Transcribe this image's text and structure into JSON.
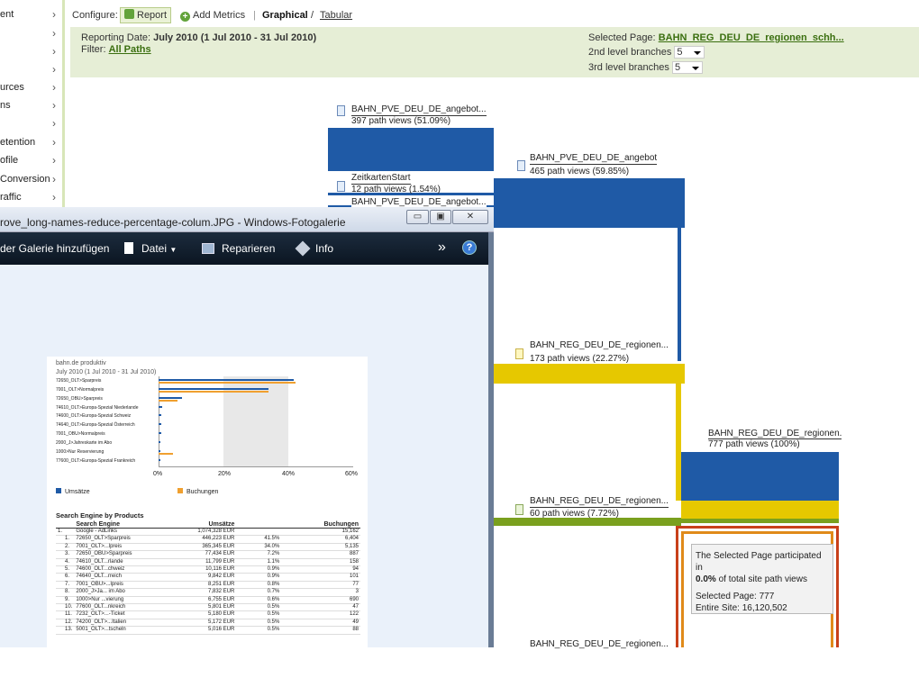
{
  "left_nav": {
    "items": [
      {
        "label": "ent"
      },
      {
        "label": ""
      },
      {
        "label": ""
      },
      {
        "label": ""
      },
      {
        "label": "urces"
      },
      {
        "label": "ns"
      },
      {
        "label": ""
      },
      {
        "label": "etention"
      },
      {
        "label": "ofile"
      },
      {
        "label": "Conversion"
      },
      {
        "label": "raffic"
      }
    ]
  },
  "config": {
    "configure_label": "Configure:",
    "report_label": "Report",
    "add_metrics_label": "Add Metrics",
    "separator": "|",
    "graphical_label": "Graphical",
    "slash": "/",
    "tabular_label": "Tabular"
  },
  "info": {
    "reporting_date_label": "Reporting Date:",
    "reporting_date_value": "July 2010 (1 Jul 2010 - 31 Jul 2010)",
    "filter_label": "Filter:",
    "filter_value": "All Paths",
    "selected_page_label": "Selected Page:",
    "selected_page_value": "BAHN_REG_DEU_DE_regionen_schh...",
    "branches2_label": "2nd level branches",
    "branches2_value": "5",
    "branches3_label": "3rd level branches",
    "branches3_value": "5"
  },
  "graph": {
    "nodes": [
      {
        "name": "BAHN_PVE_DEU_DE_angebot...",
        "views": "397 path views (51.09%)"
      },
      {
        "name": "ZeitkartenStart",
        "views": "12 path views (1.54%)"
      },
      {
        "name": "BAHN_PVE_DEU_DE_angebot...",
        "views": ""
      },
      {
        "name": "BAHN_PVE_DEU_DE_angebot",
        "views": "465 path views (59.85%)"
      },
      {
        "name": "BAHN_REG_DEU_DE_regionen...",
        "views": "173 path views (22.27%)"
      },
      {
        "name": "BAHN_REG_DEU_DE_regionen.",
        "views": "777 path views (100%)"
      },
      {
        "name": "BAHN_REG_DEU_DE_regionen...",
        "views": "60 path views (7.72%)"
      },
      {
        "name": "BAHN_REG_DEU_DE_regionen...",
        "views": ""
      }
    ],
    "tooltip": {
      "line1": "The Selected Page participated in",
      "line2_bold": "0.0%",
      "line2_rest": " of total site  path views",
      "line3": "Selected Page: 777",
      "line4": "Entire Site: 16,120,502"
    },
    "colors": {
      "blue": "#1f5aa6",
      "yellow": "#e6c800",
      "green": "#7aa01e",
      "red": "#c8401a",
      "orange": "#e08a1a"
    }
  },
  "viewer": {
    "title": "rove_long-names-reduce-percentage-colum.JPG - Windows-Fotogalerie",
    "btn_min": "▭",
    "btn_max": "▣",
    "btn_close": "✕",
    "toolbar": {
      "add_gallery": "der Galerie hinzufügen",
      "file": "Datei",
      "repair": "Reparieren",
      "info": "Info",
      "more": "»",
      "help": "?"
    }
  },
  "embedded_image": {
    "site": "bahn.de produktiv",
    "date": "July 2010 (1 Jul 2010 - 31 Jul 2010)",
    "bar_labels": [
      "72650_OLT>Sparpreis",
      "7001_OLT>Normalpreis",
      "72650_OBU>Sparpreis",
      "74610_OLT>Europa-Spezial Niederlande",
      "74600_OLT>Europa-Spezial Schweiz",
      "74640_OLT>Europa-Spezial Österreich",
      "7001_OBU>Normalpreis",
      "2000_J>Jahreskarte im Abo",
      "1000>Nur Reservierung",
      "77600_OLT>Europa-Spezial Frankreich"
    ],
    "x_ticks": [
      "0%",
      "20%",
      "40%",
      "60%"
    ],
    "legend": [
      "Umsätze",
      "Buchungen"
    ],
    "table_title": "Search Engine by Products",
    "table_headers": [
      "Search Engine",
      "Umsätze",
      "",
      "Buchungen"
    ],
    "rows": [
      [
        "1.",
        "Google - AdLinks",
        "1,074,328 EUR",
        "",
        "15,162"
      ],
      [
        "1.",
        "72650_OLT>Sparpreis",
        "446,223 EUR",
        "41.5%",
        "6,404"
      ],
      [
        "2.",
        "7001_OLT>...lpreis",
        "365,345 EUR",
        "34.0%",
        "5,135"
      ],
      [
        "3.",
        "72650_OBU>Sparpreis",
        "77,434 EUR",
        "7.2%",
        "887"
      ],
      [
        "4.",
        "74610_OLT...rlande",
        "11,799 EUR",
        "1.1%",
        "158"
      ],
      [
        "5.",
        "74600_OLT...chweiz",
        "10,116 EUR",
        "0.9%",
        "94"
      ],
      [
        "6.",
        "74640_OLT...rreich",
        "9,842 EUR",
        "0.9%",
        "101"
      ],
      [
        "7.",
        "7001_OBU>...lpreis",
        "8,251 EUR",
        "0.8%",
        "77"
      ],
      [
        "8.",
        "2000_J>Ja... im Abo",
        "7,832 EUR",
        "0.7%",
        "3"
      ],
      [
        "9.",
        "1000>Nur ...vierung",
        "6,755 EUR",
        "0.6%",
        "690"
      ],
      [
        "10.",
        "77600_OLT...nkreich",
        "5,801 EUR",
        "0.5%",
        "47"
      ],
      [
        "11.",
        "7232_OLT>...-Ticket",
        "5,180 EUR",
        "0.5%",
        "122"
      ],
      [
        "12.",
        "74200_OLT>...Italien",
        "5,172 EUR",
        "0.5%",
        "49"
      ],
      [
        "13.",
        "5001_OLT>...tscheln",
        "5,016 EUR",
        "0.5%",
        "88"
      ]
    ]
  }
}
